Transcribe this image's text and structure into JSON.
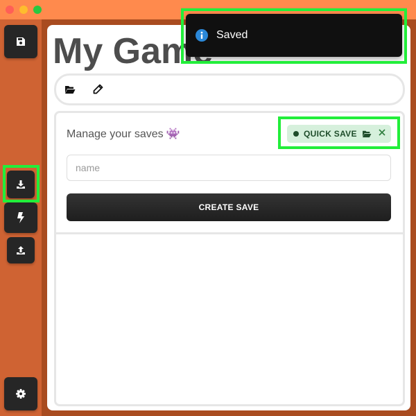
{
  "window": {
    "controls": [
      "close",
      "minimize",
      "maximize"
    ]
  },
  "sidebar": {
    "buttons": [
      {
        "name": "save-button",
        "icon": "floppy-disk-icon"
      },
      {
        "name": "load-button",
        "icon": "download-icon"
      },
      {
        "name": "quick-action-button",
        "icon": "lightning-bolt-icon"
      },
      {
        "name": "export-button",
        "icon": "upload-icon"
      },
      {
        "name": "settings-button",
        "icon": "gear-icon"
      }
    ]
  },
  "main": {
    "title": "My Game",
    "toolbar": {
      "icons": [
        "folder-open-icon",
        "pencil-icon"
      ]
    },
    "manage_label": "Manage your saves",
    "manage_emoji": "👾",
    "quick_save": {
      "label": "QUICK SAVE",
      "status_color": "#1f4d2b",
      "chip_color": "#d6f0dc"
    },
    "name_input": {
      "value": "",
      "placeholder": "name"
    },
    "create_button": "CREATE SAVE"
  },
  "toast": {
    "message": "Saved",
    "icon": "info-icon",
    "icon_color": "#2b88d8"
  },
  "colors": {
    "titlebar": "#ff8a4d",
    "sidebar": "#cf6333",
    "shell": "#a94c20",
    "highlight": "#22ee3a"
  }
}
